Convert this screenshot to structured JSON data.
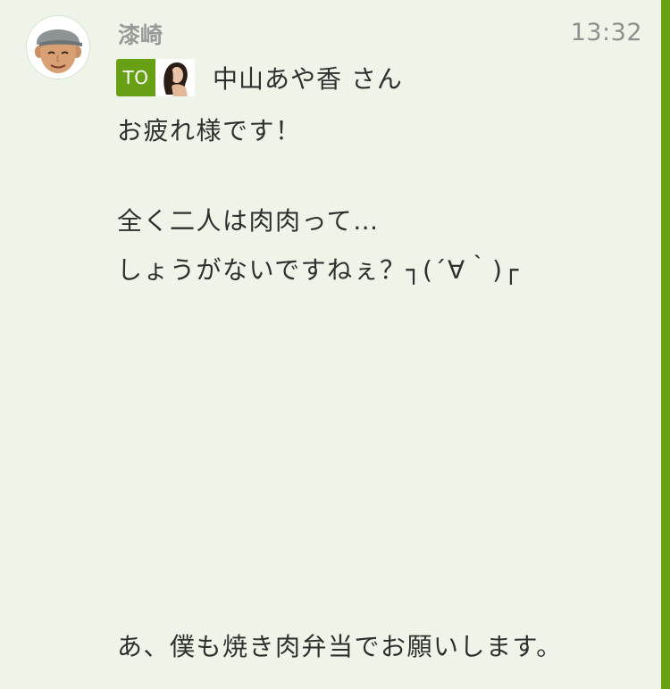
{
  "sender": {
    "name": "漆崎",
    "avatar_icon": "memoji-avatar-icon",
    "time": "13:32"
  },
  "to": {
    "badge": "TO",
    "avatar_icon": "recipient-avatar-icon",
    "recipient": "中山あや香 さん"
  },
  "body": {
    "lines": [
      "お疲れ様です！",
      "全く二人は肉肉って…",
      "しょうがないですねぇ？┐(´∀｀)┌",
      "あ、僕も焼き肉弁当でお願いします。"
    ]
  },
  "colors": {
    "background": "#eef5e8",
    "accent": "#6aa113",
    "to_badge": "#67a014"
  }
}
